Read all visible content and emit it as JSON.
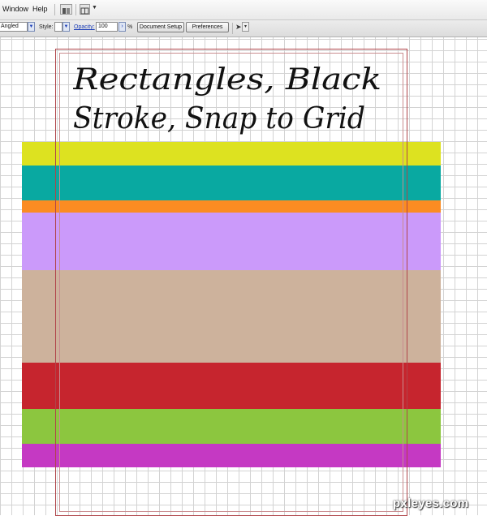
{
  "menubar": {
    "items": [
      "Window",
      "Help"
    ]
  },
  "control_bar": {
    "corner_value": "Angled",
    "style_label": "Style:",
    "opacity_label": "Opacity:",
    "opacity_value": "100",
    "opacity_unit": "%",
    "document_setup_label": "Document Setup",
    "preferences_label": "Preferences"
  },
  "canvas": {
    "handwriting": [
      "Rectangles, Black",
      "Stroke, Snap to Grid"
    ],
    "stripes": [
      {
        "name": "yellow",
        "color": "#dde220"
      },
      {
        "name": "teal",
        "color": "#09a9a1"
      },
      {
        "name": "orange",
        "color": "#fb8c22"
      },
      {
        "name": "lavender",
        "color": "#cb9afa"
      },
      {
        "name": "tan",
        "color": "#cdb29c"
      },
      {
        "name": "red",
        "color": "#c6252e"
      },
      {
        "name": "green",
        "color": "#8cc63f"
      },
      {
        "name": "magenta",
        "color": "#c539c3"
      }
    ]
  },
  "watermark": "pxleyes.com"
}
